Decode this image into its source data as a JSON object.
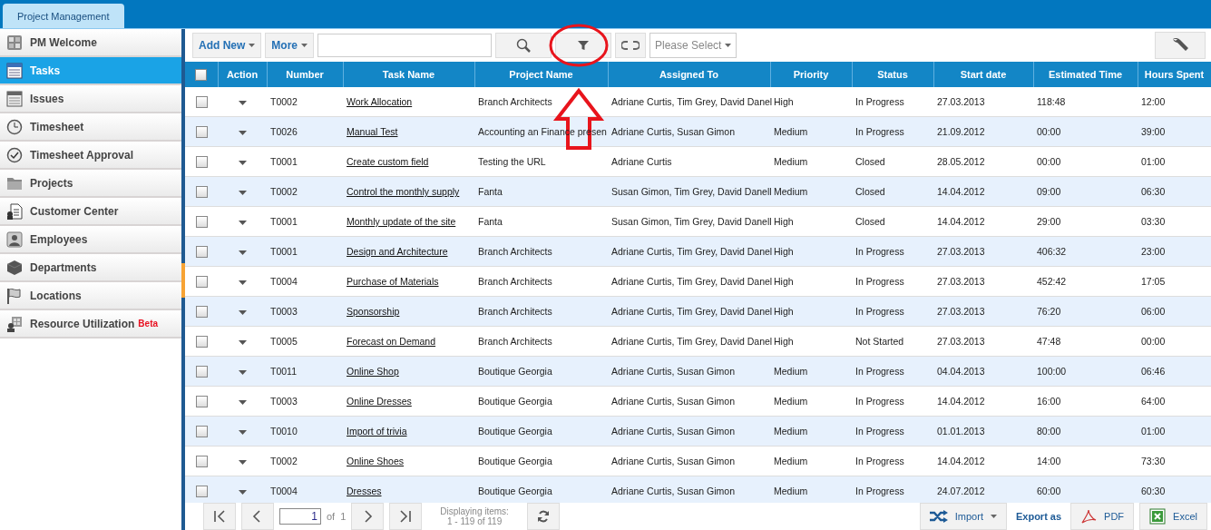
{
  "app_tab": {
    "label": "Project Management",
    "selected": true
  },
  "sidebar": {
    "items": [
      {
        "label": "PM Welcome",
        "selected": false
      },
      {
        "label": "Tasks",
        "selected": true
      },
      {
        "label": "Issues",
        "selected": false
      },
      {
        "label": "Timesheet",
        "selected": false
      },
      {
        "label": "Timesheet Approval",
        "selected": false
      },
      {
        "label": "Projects",
        "selected": false
      },
      {
        "label": "Customer Center",
        "selected": false
      },
      {
        "label": "Employees",
        "selected": false
      },
      {
        "label": "Departments",
        "selected": false
      },
      {
        "label": "Locations",
        "selected": false
      },
      {
        "label": "Resource Utilization",
        "selected": false,
        "badge": "Beta"
      }
    ]
  },
  "toolbar": {
    "add_new": "Add New",
    "more": "More",
    "select": {
      "placeholder": "Please Select"
    }
  },
  "table": {
    "columns": [
      "Action",
      "Number",
      "Task Name",
      "Project Name",
      "Assigned To",
      "Priority",
      "Status",
      "Start date",
      "Estimated Time",
      "Hours Spent"
    ],
    "select_all_checked": false,
    "rows": [
      {
        "checked": false,
        "number": "T0002",
        "task": "Work Allocation",
        "project": "Branch Architects",
        "assigned": "Adriane Curtis, Tim Grey, David Danel",
        "priority": "High",
        "status": "In Progress",
        "start": "27.03.2013",
        "estimated": "118:48",
        "spent": "12:00"
      },
      {
        "checked": false,
        "number": "T0026",
        "task": "Manual Test",
        "project": "Accounting an Finance presen",
        "assigned": "Adriane Curtis, Susan Gimon",
        "priority": "Medium",
        "status": "In Progress",
        "start": "21.09.2012",
        "estimated": "00:00",
        "spent": "39:00"
      },
      {
        "checked": false,
        "number": "T0001",
        "task": "Create custom field",
        "project": "Testing the URL",
        "assigned": "Adriane Curtis",
        "priority": "Medium",
        "status": "Closed",
        "start": "28.05.2012",
        "estimated": "00:00",
        "spent": "01:00"
      },
      {
        "checked": false,
        "number": "T0002",
        "task": "Control the monthly supply",
        "project": "Fanta",
        "assigned": "Susan Gimon, Tim Grey, David Danell",
        "priority": "Medium",
        "status": "Closed",
        "start": "14.04.2012",
        "estimated": "09:00",
        "spent": "06:30"
      },
      {
        "checked": false,
        "number": "T0001",
        "task": "Monthly update of the site",
        "project": "Fanta",
        "assigned": "Susan Gimon, Tim Grey, David Danell",
        "priority": "High",
        "status": "Closed",
        "start": "14.04.2012",
        "estimated": "29:00",
        "spent": "03:30"
      },
      {
        "checked": false,
        "number": "T0001",
        "task": "Design and Architecture",
        "project": "Branch Architects",
        "assigned": "Adriane Curtis, Tim Grey, David Danel",
        "priority": "High",
        "status": "In Progress",
        "start": "27.03.2013",
        "estimated": "406:32",
        "spent": "23:00"
      },
      {
        "checked": false,
        "number": "T0004",
        "task": "Purchase of Materials",
        "project": "Branch Architects",
        "assigned": "Adriane Curtis, Tim Grey, David Danel",
        "priority": "High",
        "status": "In Progress",
        "start": "27.03.2013",
        "estimated": "452:42",
        "spent": "17:05"
      },
      {
        "checked": false,
        "number": "T0003",
        "task": "Sponsorship",
        "project": "Branch Architects",
        "assigned": "Adriane Curtis, Tim Grey, David Danel",
        "priority": "High",
        "status": "In Progress",
        "start": "27.03.2013",
        "estimated": "76:20",
        "spent": "06:00"
      },
      {
        "checked": false,
        "number": "T0005",
        "task": "Forecast on Demand",
        "project": "Branch Architects",
        "assigned": "Adriane Curtis, Tim Grey, David Danel",
        "priority": "High",
        "status": "Not Started",
        "start": "27.03.2013",
        "estimated": "47:48",
        "spent": "00:00"
      },
      {
        "checked": false,
        "number": "T0011",
        "task": "Online Shop",
        "project": "Boutique Georgia",
        "assigned": "Adriane Curtis, Susan Gimon",
        "priority": "Medium",
        "status": "In Progress",
        "start": "04.04.2013",
        "estimated": "100:00",
        "spent": "06:46"
      },
      {
        "checked": false,
        "number": "T0003",
        "task": "Online Dresses",
        "project": "Boutique Georgia",
        "assigned": "Adriane Curtis, Susan Gimon",
        "priority": "Medium",
        "status": "In Progress",
        "start": "14.04.2012",
        "estimated": "16:00",
        "spent": "64:00"
      },
      {
        "checked": false,
        "number": "T0010",
        "task": "Import of trivia",
        "project": "Boutique Georgia",
        "assigned": "Adriane Curtis, Susan Gimon",
        "priority": "Medium",
        "status": "In Progress",
        "start": "01.01.2013",
        "estimated": "80:00",
        "spent": "01:00"
      },
      {
        "checked": false,
        "number": "T0002",
        "task": "Online Shoes",
        "project": "Boutique Georgia",
        "assigned": "Adriane Curtis, Susan Gimon",
        "priority": "Medium",
        "status": "In Progress",
        "start": "14.04.2012",
        "estimated": "14:00",
        "spent": "73:30"
      },
      {
        "checked": false,
        "number": "T0004",
        "task": "Dresses",
        "project": "Boutique Georgia",
        "assigned": "Adriane Curtis, Susan Gimon",
        "priority": "Medium",
        "status": "In Progress",
        "start": "24.07.2012",
        "estimated": "60:00",
        "spent": "60:30"
      }
    ]
  },
  "pager": {
    "page": "1",
    "of_label": "of",
    "total_pages": "1",
    "display_label": "Displaying items:",
    "display_range": "1 - 119 of 119"
  },
  "export": {
    "import": "Import",
    "export_label": "Export as",
    "pdf": "PDF",
    "excel": "Excel"
  }
}
